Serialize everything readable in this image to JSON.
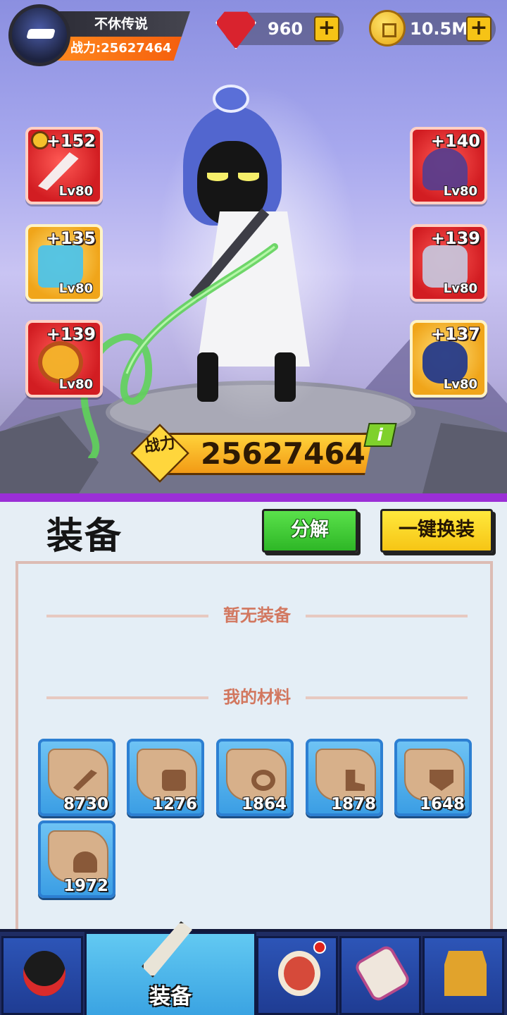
{
  "player": {
    "name": "不休传说",
    "power_label": "战力:25627464"
  },
  "currency": {
    "gems": "960",
    "coins": "10.5M",
    "gem_icon": "ruby-gem-icon",
    "coin_icon": "gold-coin-icon",
    "plus_symbol": "+"
  },
  "equipment_slots": {
    "left": [
      {
        "bonus": "+152",
        "level": "Lv80",
        "icon": "sword-icon"
      },
      {
        "bonus": "+135",
        "level": "Lv80",
        "icon": "boots-icon"
      },
      {
        "bonus": "+139",
        "level": "Lv80",
        "icon": "bracer-icon"
      }
    ],
    "right": [
      {
        "bonus": "+140",
        "level": "Lv80",
        "icon": "hat-icon"
      },
      {
        "bonus": "+139",
        "level": "Lv80",
        "icon": "armor-icon"
      },
      {
        "bonus": "+137",
        "level": "Lv80",
        "icon": "ring-icon"
      }
    ]
  },
  "power_banner": {
    "label": "战力",
    "value": "25627464",
    "info_symbol": "i"
  },
  "panel": {
    "title": "装备",
    "decompose_label": "分解",
    "one_click_equip_label": "一键换装",
    "no_equipment_text": "暂无装备",
    "materials_heading": "我的材料",
    "materials": [
      {
        "count": "8730",
        "icon": "sword-scroll-icon"
      },
      {
        "count": "1276",
        "icon": "armor-scroll-icon"
      },
      {
        "count": "1864",
        "icon": "ring-scroll-icon"
      },
      {
        "count": "1878",
        "icon": "boot-scroll-icon"
      },
      {
        "count": "1648",
        "icon": "shield-scroll-icon"
      },
      {
        "count": "1972",
        "icon": "hat-scroll-icon"
      }
    ]
  },
  "nav": {
    "active_label": "装备",
    "items": [
      "ninja-hero-icon",
      "equipment-swords-icon",
      "drum-icon",
      "scroll-icon",
      "shrine-icon"
    ]
  },
  "colors": {
    "accent_orange": "#f55f0d",
    "slot_red": "#d21d22",
    "slot_gold": "#f0a51a",
    "decompose_green": "#2eb726",
    "equip_yellow": "#f6c515",
    "material_blue": "#3b9ee4",
    "nav_blue": "#1f2c63"
  }
}
